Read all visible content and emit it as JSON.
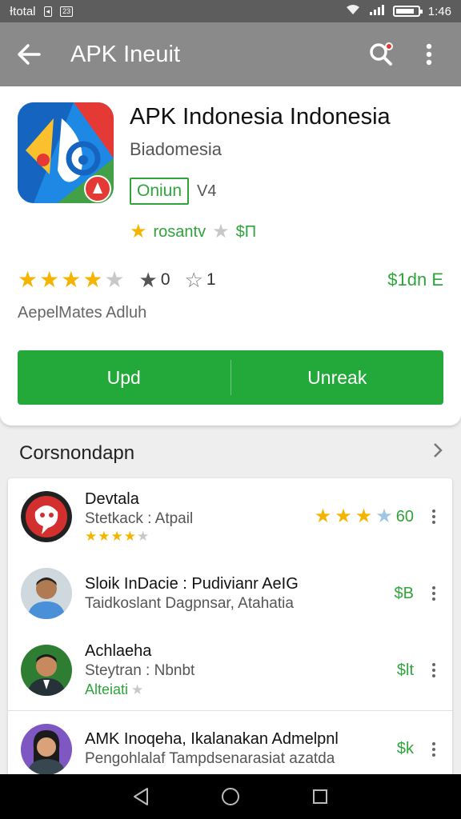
{
  "status_bar": {
    "carrier": "Ɨtotal",
    "icon_box": "23",
    "time": "1:46",
    "battery_level_fraction": 0.85
  },
  "app_bar": {
    "title": "APK Ineuit",
    "back_icon": "back-arrow-icon",
    "search_icon": "search-icon",
    "menu_icon": "more-vert-icon"
  },
  "app": {
    "title": "APK Indonesia Indonesia",
    "developer": "Biadomesia",
    "tag": "Oniun",
    "tag_extra": "V4",
    "promo_text": "rosantv",
    "promo_price": "$Π",
    "rating_fraction": 0.82,
    "stat1": "0",
    "stat2": "1",
    "size": "$1dn E",
    "meta": "AepelMates Adluh",
    "primary_action": "Upd",
    "secondary_action": "Unreak"
  },
  "section": {
    "title": "Corsnondapn"
  },
  "list": [
    {
      "name": "Devtala",
      "sub": "Stetkack : Atpail",
      "stars_filled": 4,
      "price": "60",
      "right_stars_filled": 3
    },
    {
      "name": "Sloik InDacie : Pudivianr AeIG",
      "sub": "Taidkoslant Dagpnsar, Atahatia",
      "price": "$B"
    },
    {
      "name": "Achlaeha",
      "sub": "Steytran : Nbnbt",
      "extra": "Alteiati",
      "price": "$lt"
    },
    {
      "name": "AMK Inoqeha, Ikalanakan Admelpnl",
      "sub": "Pengohlalaf Tampdsenarasiat azatda",
      "price": "$k"
    }
  ],
  "colors": {
    "accent_green": "#23a83a",
    "star_gold": "#f4b400",
    "app_bar": "#8a8a8a"
  }
}
